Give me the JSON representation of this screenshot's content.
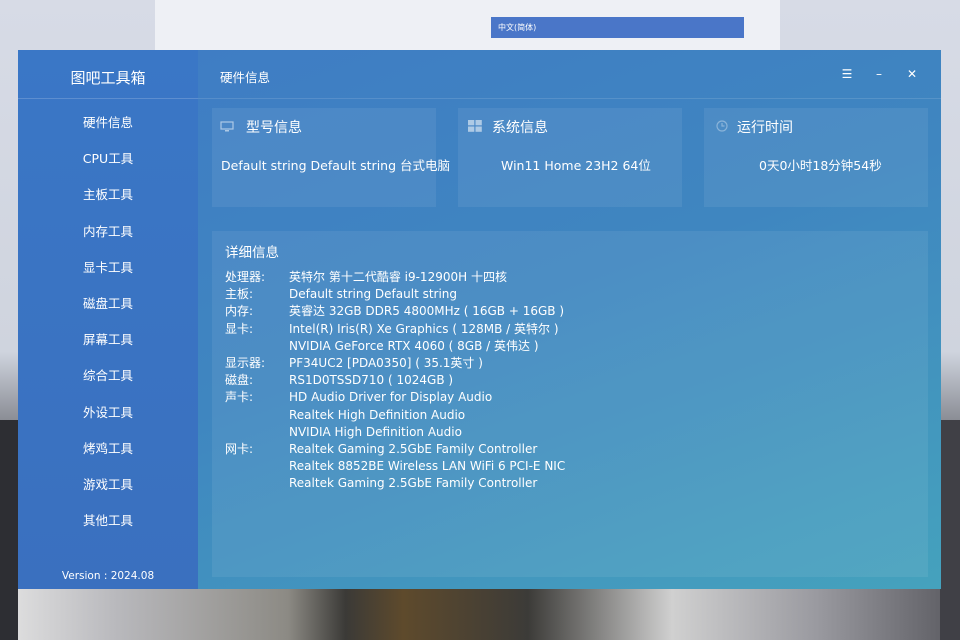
{
  "background": {
    "language_bar": "中文(简体)"
  },
  "app": {
    "title": "图吧工具箱",
    "version": "Version : 2024.08"
  },
  "sidebar": {
    "items": [
      {
        "label": "硬件信息"
      },
      {
        "label": "CPU工具"
      },
      {
        "label": "主板工具"
      },
      {
        "label": "内存工具"
      },
      {
        "label": "显卡工具"
      },
      {
        "label": "磁盘工具"
      },
      {
        "label": "屏幕工具"
      },
      {
        "label": "综合工具"
      },
      {
        "label": "外设工具"
      },
      {
        "label": "烤鸡工具"
      },
      {
        "label": "游戏工具"
      },
      {
        "label": "其他工具"
      }
    ]
  },
  "header": {
    "title": "硬件信息",
    "menu_glyph": "☰",
    "minimize_glyph": "–",
    "close_glyph": "✕"
  },
  "cards": {
    "model": {
      "title": "型号信息",
      "value": "Default string Default string 台式电脑",
      "icon": "monitor-icon"
    },
    "system": {
      "title": "系统信息",
      "value": "Win11 Home 23H2 64位",
      "icon": "windows-icon"
    },
    "uptime": {
      "title": "运行时间",
      "value": "0天0小时18分钟54秒",
      "icon": "clock-icon"
    }
  },
  "details": {
    "title": "详细信息",
    "rows": [
      {
        "label": "处理器:",
        "value": "英特尔 第十二代酷睿 i9-12900H 十四核"
      },
      {
        "label": "主板:",
        "value": "Default string Default string"
      },
      {
        "label": "内存:",
        "value": "英睿达 32GB DDR5 4800MHz ( 16GB + 16GB )"
      },
      {
        "label": "显卡:",
        "value": "Intel(R) Iris(R) Xe Graphics ( 128MB / 英特尔 )"
      },
      {
        "label": "",
        "value": "NVIDIA GeForce RTX 4060 ( 8GB / 英伟达 )"
      },
      {
        "label": "显示器:",
        "value": "PF34UC2 [PDA0350] ( 35.1英寸 )"
      },
      {
        "label": "磁盘:",
        "value": "RS1D0TSSD710 ( 1024GB )"
      },
      {
        "label": "声卡:",
        "value": "HD Audio Driver for Display Audio"
      },
      {
        "label": "",
        "value": "Realtek High Definition Audio"
      },
      {
        "label": "",
        "value": "NVIDIA High Definition Audio"
      },
      {
        "label": "网卡:",
        "value": "Realtek Gaming 2.5GbE Family Controller"
      },
      {
        "label": "",
        "value": "Realtek 8852BE Wireless LAN WiFi 6 PCI-E NIC"
      },
      {
        "label": "",
        "value": "Realtek Gaming 2.5GbE Family Controller"
      }
    ]
  }
}
